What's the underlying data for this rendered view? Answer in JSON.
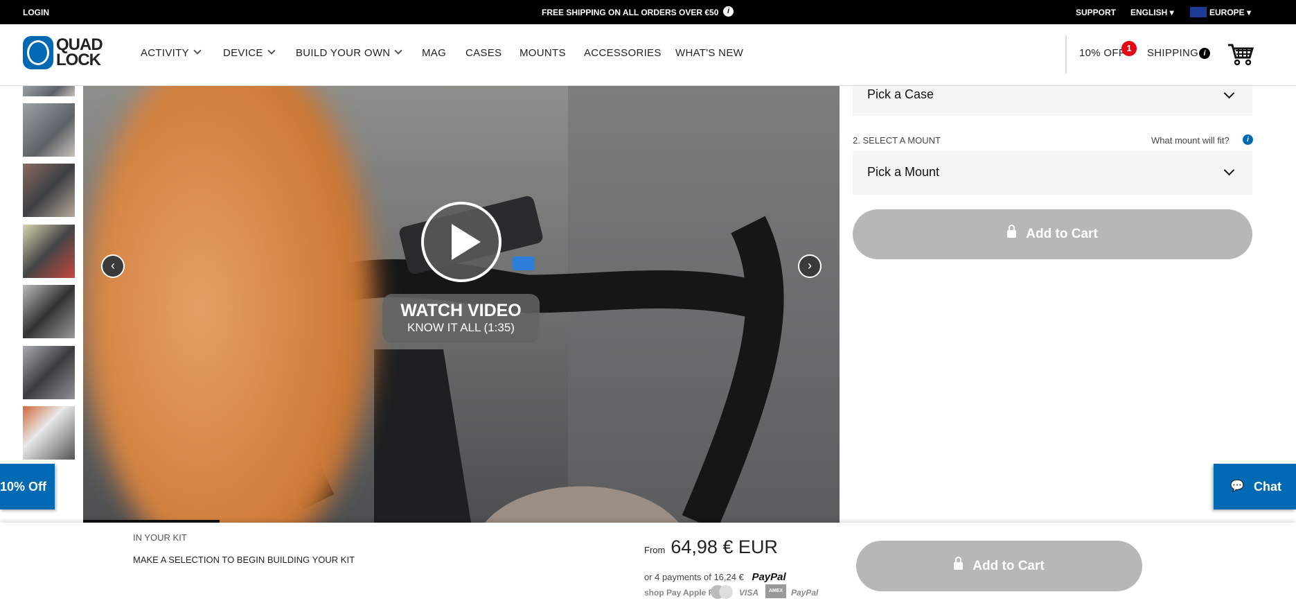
{
  "topbar": {
    "login": "LOGIN",
    "promo": "FREE SHIPPING ON ALL ORDERS OVER €50",
    "support": "SUPPORT",
    "language": "ENGLISH",
    "region": "EUROPE"
  },
  "header": {
    "logo": "QUAD LOCK",
    "nav": [
      {
        "label": "ACTIVITY",
        "dropdown": true
      },
      {
        "label": "DEVICE",
        "dropdown": true
      },
      {
        "label": "BUILD YOUR OWN",
        "dropdown": true
      },
      {
        "label": "MAG"
      },
      {
        "label": "CASES"
      },
      {
        "label": "MOUNTS"
      },
      {
        "label": "ACCESSORIES"
      },
      {
        "label": "WHAT'S NEW"
      }
    ],
    "discount": "10% OFF",
    "discount_badge": "1",
    "shipping": "SHIPPING",
    "cart_icon": "cart-icon"
  },
  "hero": {
    "watch_title": "WATCH VIDEO",
    "watch_subtitle": "KNOW IT ALL (1:35)",
    "thumbnail_count": 7
  },
  "config": {
    "case_select": "Pick a Case",
    "mount_step": "2. SELECT A MOUNT",
    "mount_help": "What mount will fit?",
    "mount_select": "Pick a Mount",
    "add_to_cart": "Add to Cart"
  },
  "widgets": {
    "discount_tab": "10% Off",
    "chat": "Chat"
  },
  "kit": {
    "heading": "IN YOUR KIT",
    "message": "MAKE A SELECTION TO BEGIN BUILDING YOUR KIT",
    "from": "From",
    "price": "64,98 € EUR",
    "installments": "or 4 payments of 16,24 €",
    "paypal": "PayPal",
    "methods": [
      "shop Pay",
      "Apple Pay",
      "Mastercard",
      "VISA",
      "AMEX",
      "PayPal"
    ],
    "add_to_cart": "Add to Cart"
  },
  "colors": {
    "brand_blue": "#0069b4",
    "button_disabled": "#b7b7b7",
    "badge_red": "#e30613"
  }
}
